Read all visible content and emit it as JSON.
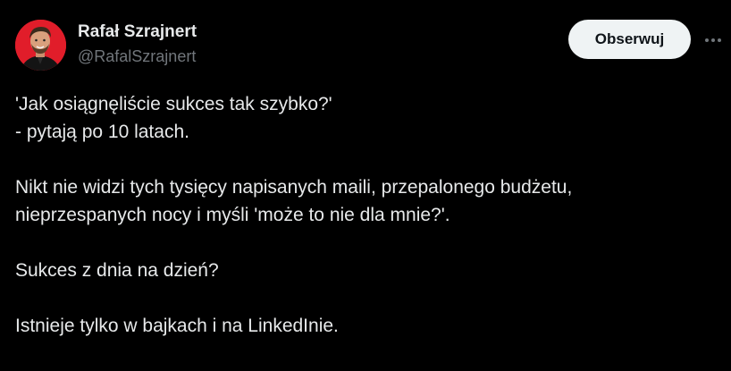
{
  "author": {
    "display_name": "Rafał Szrajnert",
    "handle": "@RafalSzrajnert",
    "avatar_bg": "#e11d2a"
  },
  "actions": {
    "follow_label": "Obserwuj",
    "more_icon": "more-horizontal-icon"
  },
  "tweet": {
    "lines": [
      "'Jak osiągnęliście sukces tak szybko?'",
      "- pytają po 10 latach.",
      "Nikt nie widzi tych tysięcy napisanych maili, przepalonego budżetu,",
      "nieprzespanych nocy i myśli 'może to nie dla mnie?'.",
      "Sukces z dnia na dzień?",
      "Istnieje tylko w bajkach i na LinkedInie."
    ]
  },
  "colors": {
    "background": "#000000",
    "text_primary": "#e7e9ea",
    "text_secondary": "#71767b",
    "button_bg": "#eff3f4",
    "button_text": "#0f1419"
  }
}
